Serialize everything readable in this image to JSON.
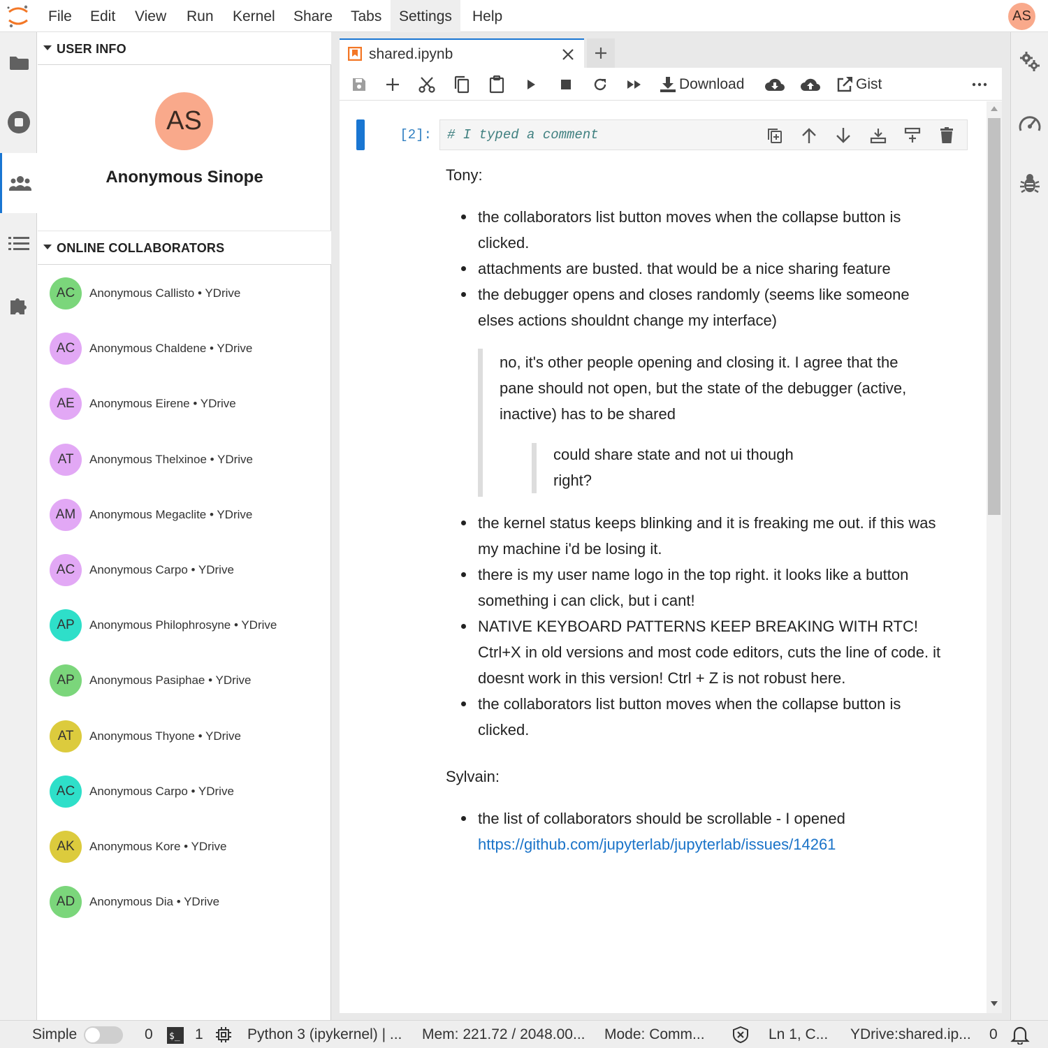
{
  "menubar": {
    "items": [
      "File",
      "Edit",
      "View",
      "Run",
      "Kernel",
      "Share",
      "Tabs",
      "Settings",
      "Help"
    ],
    "active_item": "Settings",
    "user_initials": "AS",
    "user_color": "#f9a98b"
  },
  "left_bar": {
    "icons": [
      "folder-icon",
      "stop-circle-icon",
      "users-icon",
      "list-icon",
      "extension-icon"
    ],
    "active_icon": "users-icon"
  },
  "user_info": {
    "section_title": "USER INFO",
    "initials": "AS",
    "name": "Anonymous Sinope",
    "avatar_color": "#f9a98b"
  },
  "collaborators": {
    "section_title": "ONLINE COLLABORATORS",
    "items": [
      {
        "initials": "AC",
        "name": "Anonymous Callisto • YDrive",
        "color": "#7bd67b"
      },
      {
        "initials": "AC",
        "name": "Anonymous Chaldene • YDrive",
        "color": "#e2a8f5"
      },
      {
        "initials": "AE",
        "name": "Anonymous Eirene • YDrive",
        "color": "#e2a8f5"
      },
      {
        "initials": "AT",
        "name": "Anonymous Thelxinoe • YDrive",
        "color": "#e2a8f5"
      },
      {
        "initials": "AM",
        "name": "Anonymous Megaclite • YDrive",
        "color": "#e2a8f5"
      },
      {
        "initials": "AC",
        "name": "Anonymous Carpo • YDrive",
        "color": "#e2a8f5"
      },
      {
        "initials": "AP",
        "name": "Anonymous Philophrosyne • YDrive",
        "color": "#2edfc9"
      },
      {
        "initials": "AP",
        "name": "Anonymous Pasiphae • YDrive",
        "color": "#7bd67b"
      },
      {
        "initials": "AT",
        "name": "Anonymous Thyone • YDrive",
        "color": "#dccb3d"
      },
      {
        "initials": "AC",
        "name": "Anonymous Carpo • YDrive",
        "color": "#2edfc9"
      },
      {
        "initials": "AK",
        "name": "Anonymous Kore • YDrive",
        "color": "#dccb3d"
      },
      {
        "initials": "AD",
        "name": "Anonymous Dia • YDrive",
        "color": "#7bd67b"
      }
    ]
  },
  "right_bar": {
    "icons": [
      "property-inspector-icon",
      "gauge-icon",
      "bug-icon"
    ]
  },
  "tab": {
    "title": "shared.ipynb",
    "add_label": "+"
  },
  "toolbar": {
    "download_label": "Download",
    "gist_label": "Gist",
    "more_label": "···"
  },
  "cell": {
    "prompt": "[2]:",
    "code": "# I typed a comment"
  },
  "markdown": {
    "heading_tony": "Tony:",
    "tony_items_1": [
      "the collaborators list button moves when the collapse button is clicked.",
      "attachments are busted. that would be a nice sharing feature",
      "the debugger opens and closes randomly (seems like someone elses actions shouldnt change my interface)"
    ],
    "quote_1": "no, it's other people opening and closing it. I agree that the pane should not open, but the state of the debugger (active, inactive) has to be shared",
    "quote_2": "could share state and not ui though right?",
    "tony_items_2": [
      "the kernel status keeps blinking and it is freaking me out. if this was my machine i'd be losing it.",
      "there is my user name logo in the top right. it looks like a button something i can click, but i cant!",
      "NATIVE KEYBOARD PATTERNS KEEP BREAKING WITH RTC! Ctrl+X in old versions and most code editors, cuts the line of code. it doesnt work in this version! Ctrl + Z is not robust here.",
      "the collaborators list button moves when the collapse button is clicked."
    ],
    "heading_sylvain": "Sylvain:",
    "sylvain_item_text": "the list of collaborators should be scrollable - I opened",
    "sylvain_link": "https://github.com/jupyterlab/jupyterlab/issues/14261"
  },
  "statusbar": {
    "mode_label": "Simple",
    "terminals_count": "0",
    "kernels_count": "1",
    "kernel_name": "Python 3 (ipykernel) | ...",
    "memory": "Mem: 221.72 / 2048.00...",
    "mode": "Mode: Comm...",
    "cursor": "Ln 1, C...",
    "path": "YDrive:shared.ip...",
    "notifications": "0"
  }
}
